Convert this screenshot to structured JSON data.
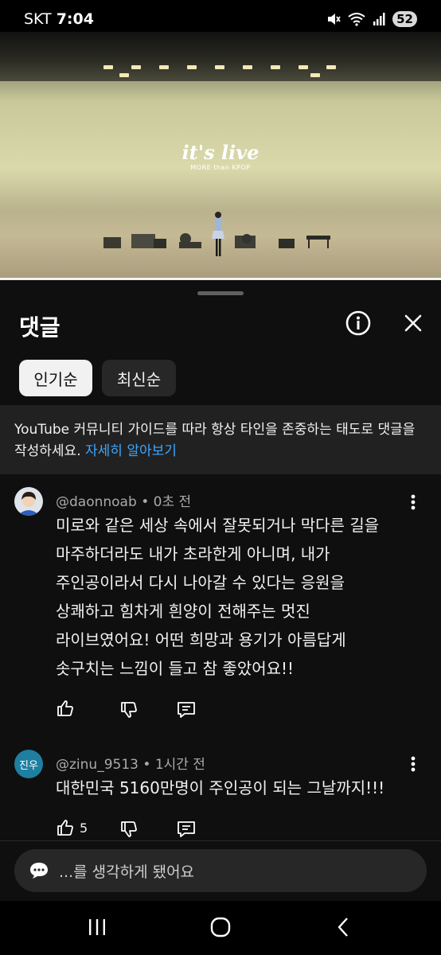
{
  "status_bar": {
    "carrier": "SKT",
    "time": "7:04",
    "battery": "52",
    "icons": [
      "mute-icon",
      "wifi-icon",
      "signal-icon"
    ]
  },
  "video": {
    "logo_main": "it's live",
    "logo_sub": "MORE than KPOP",
    "progress": 1.0
  },
  "sheet": {
    "title": "댓글",
    "info_icon": "info-icon",
    "close_icon": "close-icon"
  },
  "sort_chips": [
    {
      "label": "인기순",
      "selected": true
    },
    {
      "label": "최신순",
      "selected": false
    }
  ],
  "guide": {
    "text": "YouTube 커뮤니티 가이드를 따라 항상 타인을 존중하는 태도로 댓글을 작성하세요.",
    "link": "자세히 알아보기"
  },
  "comments": [
    {
      "author": "@daonnoab",
      "time": "0초 전",
      "lines": [
        "미로와 같은 세상 속에서 잘못되거나 막다른 길을",
        "마주하더라도 내가 초라한게 아니며, 내가",
        "주인공이라서 다시 나아갈 수 있다는 응원을",
        "상쾌하고 힘차게 흰양이 전해주는 멋진",
        "라이브였어요! 어떤 희망과 용기가 아름답게",
        "솟구치는 느낌이 들고 참 좋았어요!!"
      ],
      "likes": ""
    },
    {
      "author": "@zinu_9513",
      "time": "1시간 전",
      "avatar_text": "진우",
      "lines": [
        "대한민국 5160만명이 주인공이 되는 그날까지!!!"
      ],
      "likes": "5"
    }
  ],
  "input": {
    "placeholder": "...를 생각하게 됐어요",
    "icon": "chat-bubble-icon"
  },
  "nav": {
    "icons": [
      "recent-apps-icon",
      "home-icon",
      "back-icon"
    ]
  },
  "colors": {
    "background": "#0f0f0f",
    "link": "#3ea6ff",
    "chip_active": "#f1f1f1",
    "chip_inactive": "#272727"
  }
}
